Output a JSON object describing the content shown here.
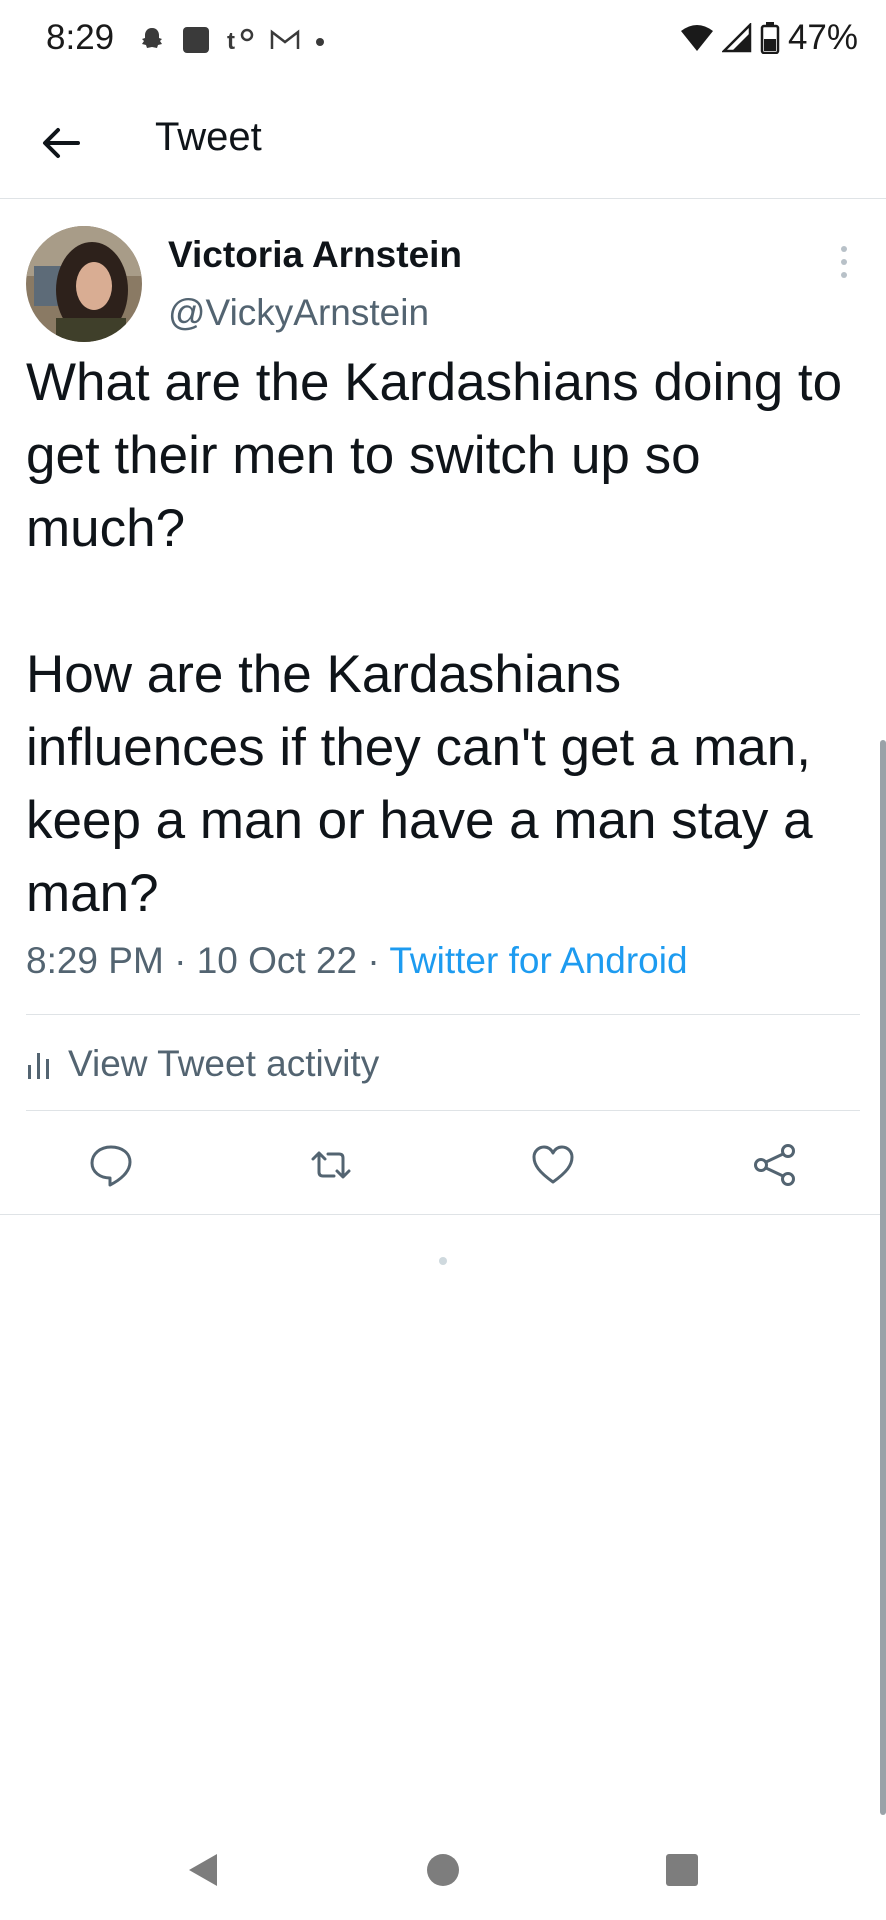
{
  "status_bar": {
    "time": "8:29",
    "battery": "47%",
    "left_icons": [
      "snapchat-icon",
      "app-icon",
      "tiktok-icon",
      "gmail-icon",
      "dot-icon"
    ],
    "right_icons": [
      "wifi-icon",
      "signal-icon",
      "battery-icon"
    ]
  },
  "app_bar": {
    "title": "Tweet",
    "back_icon": "arrow-left-icon"
  },
  "tweet": {
    "author_name": "Victoria Arnstein",
    "author_handle": "@VickyArnstein",
    "text": "What are the Kardashians doing to get their men to switch up so much?\n\nHow are the Kardashians influences if they can't get a man, keep a man or have a man stay a man?",
    "time": "8:29 PM",
    "separator": "·",
    "date": "10 Oct 22",
    "source": "Twitter for Android"
  },
  "activity": {
    "label": "View Tweet activity",
    "icon": "bar-chart-icon"
  },
  "actions": [
    "reply-icon",
    "retweet-icon",
    "like-icon",
    "share-icon"
  ],
  "colors": {
    "link": "#1d9bf0",
    "secondary_text": "#536471",
    "divider": "#dfe3e6"
  }
}
